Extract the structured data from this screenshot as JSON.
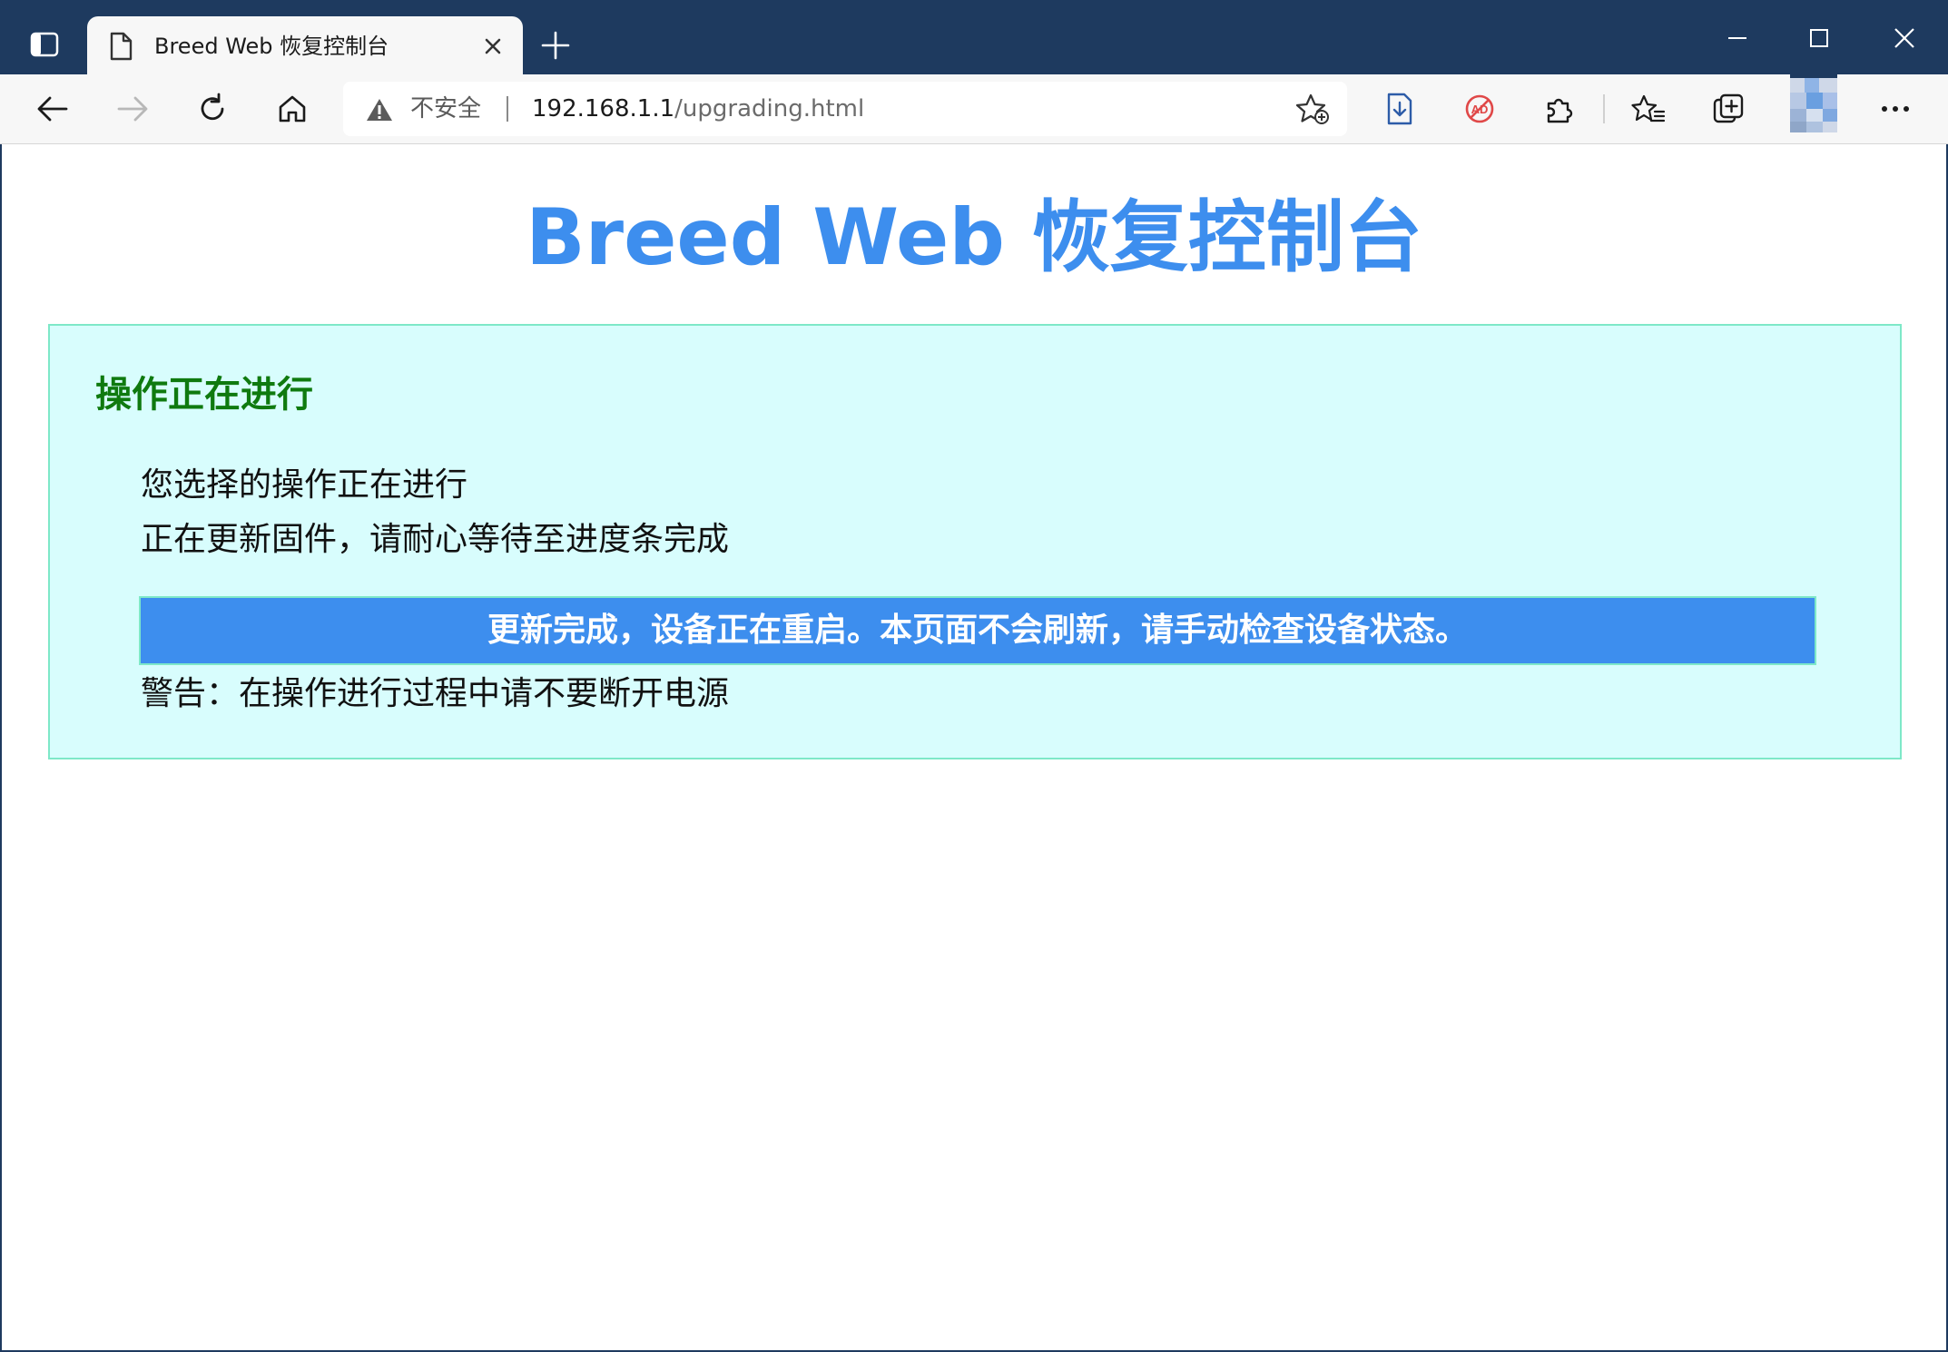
{
  "window": {
    "tab_title": "Breed Web 恢复控制台",
    "controls": [
      "minimize",
      "maximize",
      "close"
    ]
  },
  "toolbar": {
    "security_label": "不安全",
    "url_host": "192.168.1.1",
    "url_path": "/upgrading.html",
    "icons": [
      "back-icon",
      "forward-icon",
      "refresh-icon",
      "home-icon",
      "add-favorite-icon",
      "download-extension-icon",
      "adblock-icon",
      "extensions-icon",
      "favorites-icon",
      "collections-icon",
      "profile-avatar",
      "more-icon"
    ]
  },
  "page": {
    "heading": "Breed Web 恢复控制台",
    "panel": {
      "title": "操作正在进行",
      "line1": "您选择的操作正在进行",
      "line2": "正在更新固件，请耐心等待至进度条完成",
      "progress_text": "更新完成，设备正在重启。本页面不会刷新，请手动检查设备状态。",
      "progress_percent": 100,
      "warning": "警告：在操作进行过程中请不要断开电源"
    }
  },
  "colors": {
    "titlebar": "#1e3a5f",
    "heading": "#3d8eee",
    "panel_bg": "#d8fdfd",
    "panel_border": "#7ee8c8",
    "panel_title": "#0f7a0f",
    "progress_fill": "#3d8eee"
  }
}
